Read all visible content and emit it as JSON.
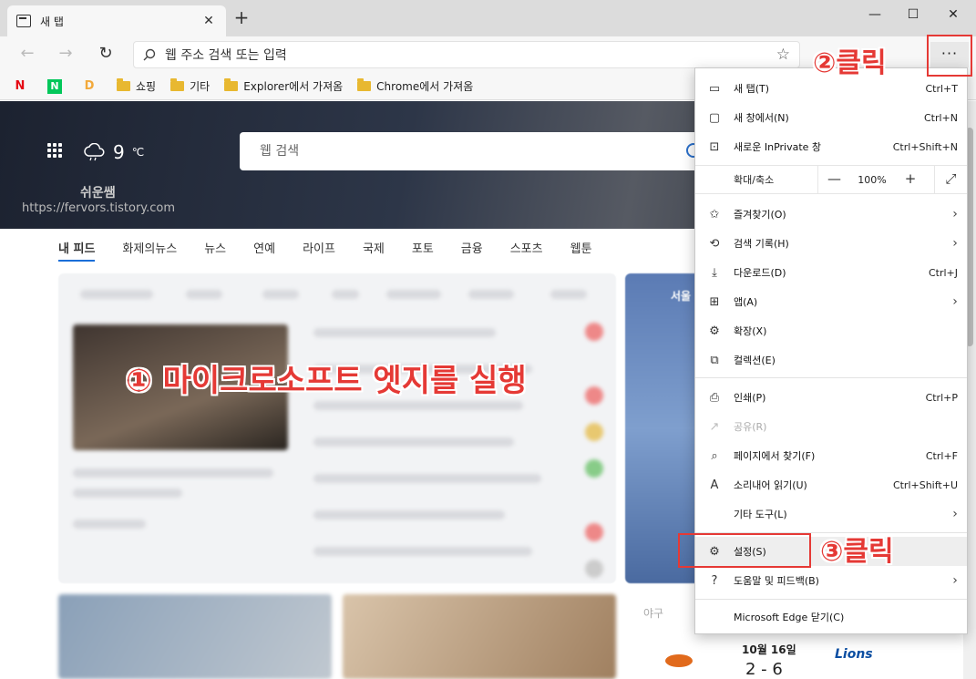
{
  "tab": {
    "title": "새 탭",
    "close": "✕"
  },
  "window": {
    "minimize": "—",
    "maximize": "☐",
    "close": "✕",
    "new_tab": "+"
  },
  "nav": {
    "back": "←",
    "forward": "→",
    "refresh": "↻",
    "address_placeholder": "웹 주소 검색 또는 입력",
    "star": "☆",
    "menu": "···"
  },
  "favorites": [
    {
      "label": "",
      "logo": "N",
      "color": "#e50914"
    },
    {
      "label": "",
      "logo": "N",
      "color": "#03c75a"
    },
    {
      "label": "",
      "logo": "D",
      "color": "#f2a93b"
    },
    {
      "label": "쇼핑",
      "type": "folder"
    },
    {
      "label": "기타",
      "type": "folder"
    },
    {
      "label": "Explorer에서 가져옴",
      "type": "folder"
    },
    {
      "label": "Chrome에서 가져옴",
      "type": "folder"
    }
  ],
  "hero": {
    "temp": "9",
    "unit": "℃",
    "search_placeholder": "웹 검색",
    "watermark": "쉬운쌤",
    "watermark_url": "https://fervors.tistory.com"
  },
  "news_tabs": [
    "내 피드",
    "화제의뉴스",
    "뉴스",
    "연예",
    "라이프",
    "국제",
    "포토",
    "금융",
    "스포츠",
    "웹툰"
  ],
  "side_panel": {
    "city": "서울"
  },
  "baseball": {
    "label": "야구",
    "date": "10월 16일",
    "score": "2 - 6",
    "team2": "Lions"
  },
  "menu": {
    "items": [
      {
        "icon": "▭",
        "label": "새 탭(T)",
        "shortcut": "Ctrl+T"
      },
      {
        "icon": "▢",
        "label": "새 창에서(N)",
        "shortcut": "Ctrl+N"
      },
      {
        "icon": "⊡",
        "label": "새로운 InPrivate 창",
        "shortcut": "Ctrl+Shift+N"
      }
    ],
    "zoom": {
      "label": "확대/축소",
      "minus": "—",
      "value": "100%",
      "plus": "+",
      "fullscreen": "⤢"
    },
    "items2": [
      {
        "icon": "✩",
        "label": "즐겨찾기(O)",
        "shortcut": "",
        "arrow": "›"
      },
      {
        "icon": "⟲",
        "label": "검색 기록(H)",
        "shortcut": "",
        "arrow": "›"
      },
      {
        "icon": "⤓",
        "label": "다운로드(D)",
        "shortcut": "Ctrl+J"
      },
      {
        "icon": "⊞",
        "label": "앱(A)",
        "shortcut": "",
        "arrow": "›"
      },
      {
        "icon": "⚙",
        "label": "확장(X)",
        "shortcut": ""
      },
      {
        "icon": "⧉",
        "label": "컬렉션(E)",
        "shortcut": ""
      }
    ],
    "items3": [
      {
        "icon": "⎙",
        "label": "인쇄(P)",
        "shortcut": "Ctrl+P"
      },
      {
        "icon": "↗",
        "label": "공유(R)",
        "shortcut": "",
        "disabled": true
      },
      {
        "icon": "⌕",
        "label": "페이지에서 찾기(F)",
        "shortcut": "Ctrl+F"
      },
      {
        "icon": "A",
        "label": "소리내어 읽기(U)",
        "shortcut": "Ctrl+Shift+U"
      },
      {
        "icon": "",
        "label": "기타 도구(L)",
        "shortcut": "",
        "arrow": "›"
      }
    ],
    "items4": [
      {
        "icon": "⚙",
        "label": "설정(S)",
        "shortcut": ""
      },
      {
        "icon": "?",
        "label": "도움말 및 피드백(B)",
        "shortcut": "",
        "arrow": "›"
      }
    ],
    "close_item": {
      "label": "Microsoft Edge 닫기(C)"
    }
  },
  "annotations": {
    "step1": "① 마이크로소프트 엣지를 실행",
    "step2": "②클릭",
    "step3": "③클릭",
    "color": "#e53935"
  }
}
